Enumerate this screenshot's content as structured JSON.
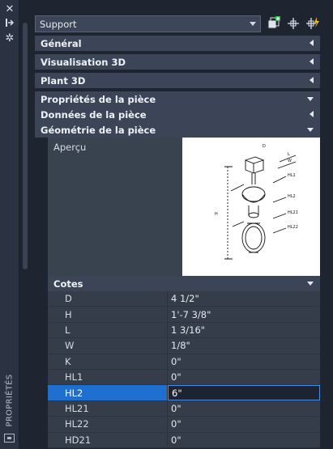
{
  "window": {
    "vertical_title": "PROPRIÉTÉS",
    "close_icon": "close-icon",
    "autohide_icon": "pin-icon",
    "settings_icon": "gear-icon"
  },
  "header": {
    "object_type": "Support",
    "toolbar": {
      "toggle_pickadd": "toggle-pickadd-icon",
      "select_objects": "select-objects-icon",
      "quick_select": "quick-select-icon"
    }
  },
  "sections": [
    {
      "label": "Général",
      "state": "collapsed"
    },
    {
      "label": "Visualisation 3D",
      "state": "collapsed"
    },
    {
      "label": "Plant 3D",
      "state": "collapsed"
    },
    {
      "label": "Propriétés de la pièce",
      "state": "expanded"
    },
    {
      "label": "Données de la pièce",
      "state": "collapsed"
    },
    {
      "label": "Géométrie de la pièce",
      "state": "expanded"
    }
  ],
  "preview": {
    "label": "Aperçu",
    "diagram_labels": [
      "D",
      "L",
      "W",
      "H",
      "HL1",
      "HL2",
      "HL21",
      "HL22"
    ]
  },
  "cotes": {
    "label": "Cotes",
    "rows": [
      {
        "name": "D",
        "value": "4 1/2\""
      },
      {
        "name": "H",
        "value": "1'-7 3/8\""
      },
      {
        "name": "L",
        "value": "1 3/16\""
      },
      {
        "name": "W",
        "value": "1/8\""
      },
      {
        "name": "K",
        "value": "0\""
      },
      {
        "name": "HL1",
        "value": "0\""
      },
      {
        "name": "HL2",
        "value": "6\"",
        "selected": true
      },
      {
        "name": "HL21",
        "value": "0\""
      },
      {
        "name": "HL22",
        "value": "0\""
      },
      {
        "name": "HD21",
        "value": "0\""
      }
    ]
  },
  "colors": {
    "background": "#1e2430",
    "section_header": "#3b4557",
    "selection": "#1f6fd0"
  }
}
